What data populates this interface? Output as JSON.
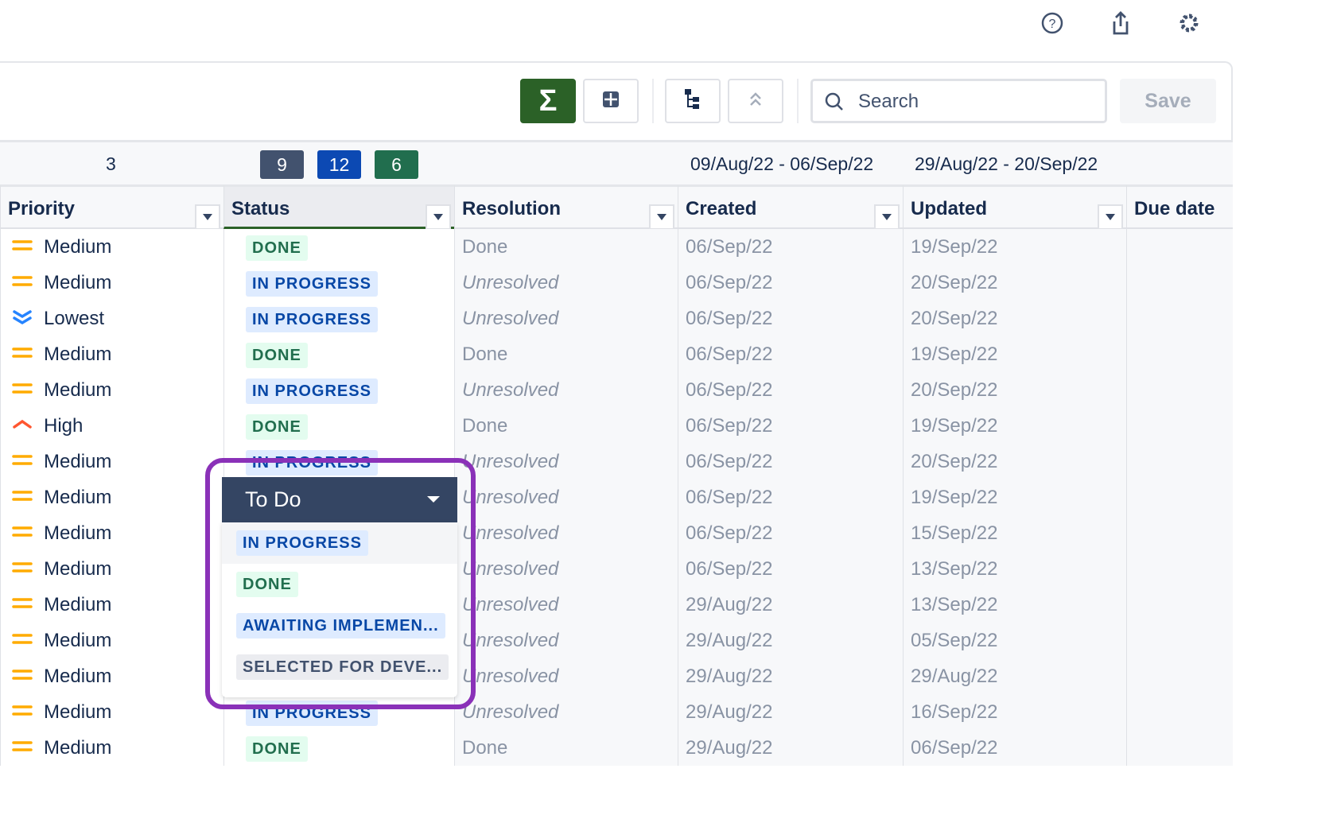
{
  "top_icons": [
    "help-icon",
    "share-icon",
    "gear-icon"
  ],
  "toolbar": {
    "search_placeholder": "Search",
    "save_label": "Save",
    "accent": "#2b6127"
  },
  "summary": {
    "count": "3",
    "badges": [
      {
        "value": "9",
        "color": "#42526e"
      },
      {
        "value": "12",
        "color": "#0c49b3"
      },
      {
        "value": "6",
        "color": "#216e4e"
      }
    ],
    "created_range": "09/Aug/22 - 06/Sep/22",
    "updated_range": "29/Aug/22 - 20/Sep/22"
  },
  "columns": [
    "Priority",
    "Status",
    "Resolution",
    "Created",
    "Updated",
    "Due date"
  ],
  "rows": [
    {
      "priority": "Medium",
      "status": "DONE",
      "resolution": "Done",
      "created": "06/Sep/22",
      "updated": "19/Sep/22"
    },
    {
      "priority": "Medium",
      "status": "IN PROGRESS",
      "resolution": "Unresolved",
      "created": "06/Sep/22",
      "updated": "20/Sep/22"
    },
    {
      "priority": "Lowest",
      "status": "IN PROGRESS",
      "resolution": "Unresolved",
      "created": "06/Sep/22",
      "updated": "20/Sep/22"
    },
    {
      "priority": "Medium",
      "status": "DONE",
      "resolution": "Done",
      "created": "06/Sep/22",
      "updated": "19/Sep/22"
    },
    {
      "priority": "Medium",
      "status": "IN PROGRESS",
      "resolution": "Unresolved",
      "created": "06/Sep/22",
      "updated": "20/Sep/22"
    },
    {
      "priority": "High",
      "status": "DONE",
      "resolution": "Done",
      "created": "06/Sep/22",
      "updated": "19/Sep/22"
    },
    {
      "priority": "Medium",
      "status": "IN PROGRESS",
      "resolution": "Unresolved",
      "created": "06/Sep/22",
      "updated": "20/Sep/22"
    },
    {
      "priority": "Medium",
      "status": "",
      "resolution": "Unresolved",
      "created": "06/Sep/22",
      "updated": "19/Sep/22"
    },
    {
      "priority": "Medium",
      "status": "",
      "resolution": "Unresolved",
      "created": "06/Sep/22",
      "updated": "15/Sep/22"
    },
    {
      "priority": "Medium",
      "status": "",
      "resolution": "Unresolved",
      "created": "06/Sep/22",
      "updated": "13/Sep/22"
    },
    {
      "priority": "Medium",
      "status": "",
      "resolution": "Unresolved",
      "created": "29/Aug/22",
      "updated": "13/Sep/22"
    },
    {
      "priority": "Medium",
      "status": "",
      "resolution": "Unresolved",
      "created": "29/Aug/22",
      "updated": "05/Sep/22"
    },
    {
      "priority": "Medium",
      "status": "",
      "resolution": "Unresolved",
      "created": "29/Aug/22",
      "updated": "29/Aug/22"
    },
    {
      "priority": "Medium",
      "status": "IN PROGRESS",
      "resolution": "Unresolved",
      "created": "29/Aug/22",
      "updated": "16/Sep/22"
    },
    {
      "priority": "Medium",
      "status": "DONE",
      "resolution": "Done",
      "created": "29/Aug/22",
      "updated": "06/Sep/22"
    }
  ],
  "dropdown": {
    "selected": "To Do",
    "options": [
      {
        "label": "IN PROGRESS",
        "kind": "prog"
      },
      {
        "label": "DONE",
        "kind": "done"
      },
      {
        "label": "AWAITING IMPLEMEN...",
        "kind": "prog"
      },
      {
        "label": "SELECTED FOR DEVE...",
        "kind": "sel"
      }
    ],
    "highlight_color": "#8a31b8"
  }
}
